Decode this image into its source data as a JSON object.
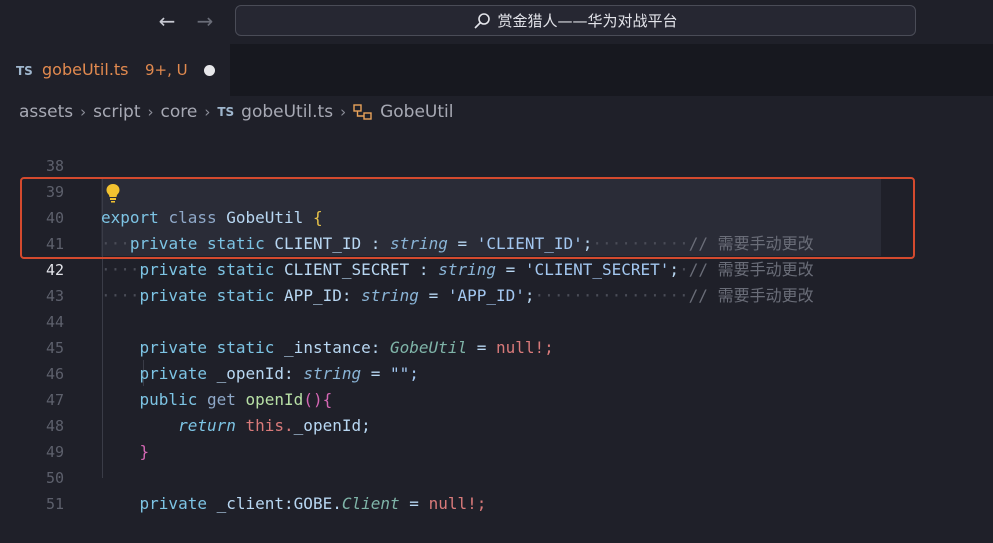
{
  "titlebar": {
    "back_icon": "arrow-left-icon",
    "forward_icon": "arrow-right-icon",
    "search_text": "赏金猎人——华为对战平台"
  },
  "tab": {
    "type_badge": "TS",
    "filename": "gobeUtil.ts",
    "status": "9+, U"
  },
  "breadcrumb": {
    "items": [
      "assets",
      "script",
      "core",
      "gobeUtil.ts",
      "GobeUtil"
    ],
    "ts_badge": "TS"
  },
  "editor": {
    "line_numbers": [
      "38",
      "39",
      "40",
      "41",
      "42",
      "43",
      "44",
      "45",
      "46",
      "47",
      "48",
      "49",
      "50",
      "51"
    ],
    "active_line": "42",
    "lines": {
      "l39": {
        "a": "export",
        "b": "class",
        "c": "GobeUtil",
        "d": "{"
      },
      "l40": {
        "a": "private",
        "b": "static",
        "c": "CLIENT_ID",
        "d": ":",
        "e": "string",
        "f": "=",
        "g": "'CLIENT_ID'",
        "h": ";",
        "i": "//",
        "j": "需要手动更改"
      },
      "l41": {
        "a": "private",
        "b": "static",
        "c": "CLIENT_SECRET",
        "d": ":",
        "e": "string",
        "f": "=",
        "g": "'CLIENT_SECRET'",
        "h": ";",
        "i": "//",
        "j": "需要手动更改"
      },
      "l42": {
        "a": "private",
        "b": "static",
        "c": "APP_ID:",
        "e": "string",
        "f": "=",
        "g": "'APP_ID'",
        "h": ";",
        "i": "//",
        "j": "需要手动更改"
      },
      "l44": {
        "a": "private",
        "b": "static",
        "c": "_instance:",
        "e": "GobeUtil",
        "f": "=",
        "g": "null!;"
      },
      "l45": {
        "a": "private",
        "c": "_openId:",
        "e": "string",
        "f": "=",
        "g": "\"\";"
      },
      "l46": {
        "a": "public",
        "b": "get",
        "c": "openId",
        "d": "(){"
      },
      "l47": {
        "a": "return",
        "b": "this.",
        "c": "_openId;"
      },
      "l48": {
        "a": "}"
      },
      "l50": {
        "a": "private",
        "c": "_client:",
        "b": "GOBE.",
        "e": "Client",
        "f": "=",
        "g": "null!;"
      }
    }
  },
  "colors": {
    "background": "#1f2029",
    "highlight_border": "#d44a2e",
    "tab_modified": "#e28a4f"
  }
}
